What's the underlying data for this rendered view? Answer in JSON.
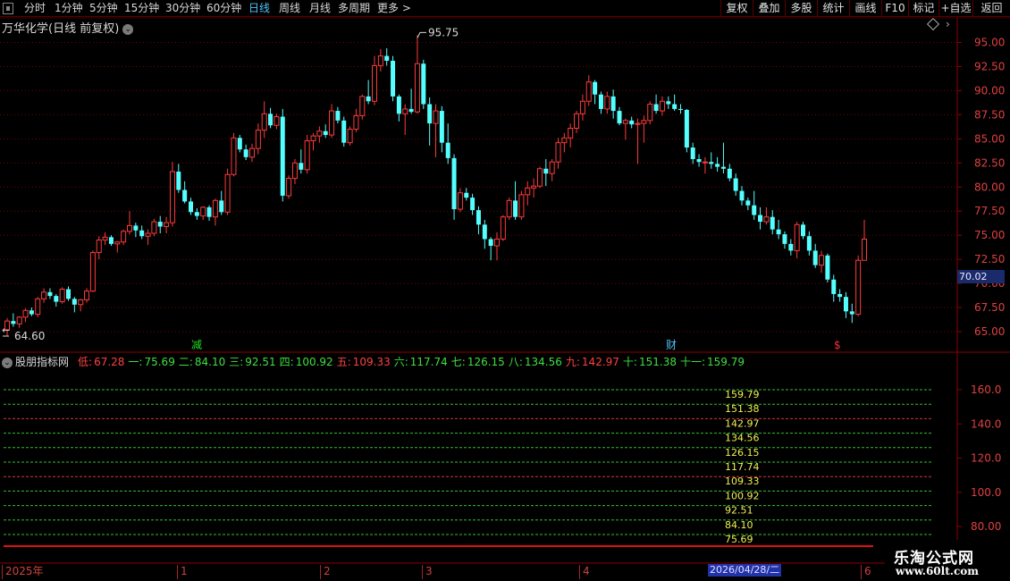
{
  "toolbar": {
    "periods": [
      {
        "label": "分时",
        "active": false
      },
      {
        "label": "1分钟",
        "active": false
      },
      {
        "label": "5分钟",
        "active": false
      },
      {
        "label": "15分钟",
        "active": false
      },
      {
        "label": "30分钟",
        "active": false
      },
      {
        "label": "60分钟",
        "active": false
      },
      {
        "label": "日线",
        "active": true
      },
      {
        "label": "周线",
        "active": false
      },
      {
        "label": "月线",
        "active": false
      },
      {
        "label": "多周期",
        "active": false
      },
      {
        "label": "更多 >",
        "active": false
      }
    ],
    "tools": [
      "复权",
      "叠加",
      "多股",
      "统计",
      "画线",
      "F10",
      "标记",
      "+自选",
      "返回"
    ]
  },
  "stock": {
    "title": "万华化学(日线 前复权)",
    "high_label": "95.75",
    "low_label": "64.60",
    "current_price": "70.02"
  },
  "price_axis": {
    "ticks": [
      "95.00",
      "92.50",
      "90.00",
      "87.50",
      "85.00",
      "82.50",
      "80.00",
      "77.50",
      "75.00",
      "72.50",
      "70.00",
      "67.50",
      "65.00"
    ]
  },
  "markers": [
    {
      "label": "减",
      "color": "#22dd22"
    },
    {
      "label": "财",
      "color": "#4fc3f7"
    },
    {
      "label": "$",
      "color": "#ff3030"
    }
  ],
  "indicator": {
    "name": "股朋指标网",
    "items": [
      {
        "label": "低:",
        "value": "67.28",
        "color": "#ff4040"
      },
      {
        "label": "一:",
        "value": "75.69",
        "color": "#3ee03e"
      },
      {
        "label": "二:",
        "value": "84.10",
        "color": "#3ee03e"
      },
      {
        "label": "三:",
        "value": "92.51",
        "color": "#3ee03e"
      },
      {
        "label": "四:",
        "value": "100.92",
        "color": "#3ee03e"
      },
      {
        "label": "五:",
        "value": "109.33",
        "color": "#ff4040"
      },
      {
        "label": "六:",
        "value": "117.74",
        "color": "#3ee03e"
      },
      {
        "label": "七:",
        "value": "126.15",
        "color": "#3ee03e"
      },
      {
        "label": "八:",
        "value": "134.56",
        "color": "#3ee03e"
      },
      {
        "label": "九:",
        "value": "142.97",
        "color": "#ff4040"
      },
      {
        "label": "十:",
        "value": "151.38",
        "color": "#3ee03e"
      },
      {
        "label": "十一:",
        "value": "159.79",
        "color": "#3ee03e"
      }
    ],
    "levels": [
      {
        "value": "159.79",
        "color": "#3ee03e"
      },
      {
        "value": "151.38",
        "color": "#3ee03e"
      },
      {
        "value": "142.97",
        "color": "#ff4040"
      },
      {
        "value": "134.56",
        "color": "#3ee03e"
      },
      {
        "value": "126.15",
        "color": "#3ee03e"
      },
      {
        "value": "117.74",
        "color": "#3ee03e"
      },
      {
        "value": "109.33",
        "color": "#ff4040"
      },
      {
        "value": "100.92",
        "color": "#3ee03e"
      },
      {
        "value": "92.51",
        "color": "#3ee03e"
      },
      {
        "value": "84.10",
        "color": "#3ee03e"
      },
      {
        "value": "75.69",
        "color": "#3ee03e"
      }
    ],
    "axis_ticks": [
      "160.0",
      "140.0",
      "120.0",
      "100.0",
      "80.00"
    ]
  },
  "date_axis": {
    "ticks": [
      "2025年",
      "1",
      "2",
      "3",
      "4",
      "5",
      "6"
    ],
    "cursor_date": "2026/04/28/二"
  },
  "watermark": {
    "title": "乐淘公式网",
    "url": "www.60lt.com"
  },
  "colors": {
    "up": "#ff3b3b",
    "down": "#54ffff",
    "frame": "#8b0000",
    "grid": "#7a0000"
  },
  "candles": [
    [
      65.2,
      66.4,
      64.6,
      66.1
    ],
    [
      66.1,
      66.9,
      65.5,
      65.8
    ],
    [
      65.8,
      66.6,
      65.4,
      66.5
    ],
    [
      66.5,
      67.4,
      66.0,
      67.2
    ],
    [
      67.2,
      67.5,
      66.6,
      66.8
    ],
    [
      66.8,
      68.6,
      66.5,
      68.4
    ],
    [
      68.4,
      69.5,
      68.0,
      69.1
    ],
    [
      69.1,
      69.5,
      68.4,
      68.7
    ],
    [
      68.7,
      68.9,
      67.6,
      68.1
    ],
    [
      68.1,
      69.6,
      67.9,
      69.4
    ],
    [
      69.4,
      69.7,
      68.2,
      68.4
    ],
    [
      68.4,
      68.6,
      67.0,
      67.8
    ],
    [
      67.8,
      68.4,
      67.1,
      68.3
    ],
    [
      68.3,
      69.5,
      68.0,
      69.2
    ],
    [
      69.2,
      73.4,
      69.1,
      73.2
    ],
    [
      73.2,
      74.9,
      72.5,
      74.5
    ],
    [
      74.5,
      75.3,
      74.0,
      74.8
    ],
    [
      74.8,
      75.0,
      73.9,
      74.1
    ],
    [
      74.1,
      74.4,
      73.2,
      74.3
    ],
    [
      74.3,
      75.6,
      74.0,
      75.4
    ],
    [
      75.4,
      77.5,
      75.1,
      76.0
    ],
    [
      76.0,
      76.3,
      74.8,
      75.5
    ],
    [
      75.5,
      76.0,
      74.6,
      74.9
    ],
    [
      74.9,
      75.6,
      74.0,
      75.2
    ],
    [
      75.2,
      76.7,
      74.9,
      76.4
    ],
    [
      76.4,
      77.0,
      75.2,
      75.9
    ],
    [
      75.9,
      76.9,
      75.2,
      76.3
    ],
    [
      76.3,
      82.6,
      75.9,
      81.6
    ],
    [
      81.6,
      82.4,
      79.4,
      79.7
    ],
    [
      79.7,
      80.6,
      78.3,
      78.5
    ],
    [
      78.5,
      78.9,
      77.1,
      77.4
    ],
    [
      77.4,
      77.8,
      76.6,
      77.0
    ],
    [
      77.0,
      78.0,
      76.6,
      77.9
    ],
    [
      77.9,
      78.1,
      76.5,
      76.9
    ],
    [
      76.9,
      78.8,
      76.0,
      78.6
    ],
    [
      78.6,
      79.6,
      77.1,
      77.4
    ],
    [
      77.4,
      81.9,
      77.1,
      81.3
    ],
    [
      81.3,
      85.6,
      81.1,
      85.1
    ],
    [
      85.1,
      85.4,
      83.6,
      83.9
    ],
    [
      83.9,
      84.4,
      82.8,
      83.1
    ],
    [
      83.1,
      84.5,
      82.6,
      84.0
    ],
    [
      84.0,
      86.6,
      83.4,
      85.9
    ],
    [
      85.9,
      88.9,
      85.1,
      87.6
    ],
    [
      87.6,
      88.2,
      86.1,
      86.4
    ],
    [
      86.4,
      87.6,
      86.0,
      87.3
    ],
    [
      87.3,
      88.1,
      78.5,
      79.1
    ],
    [
      79.1,
      81.2,
      78.8,
      80.9
    ],
    [
      80.9,
      82.9,
      80.3,
      82.5
    ],
    [
      82.5,
      83.9,
      81.4,
      81.8
    ],
    [
      81.8,
      85.4,
      81.4,
      84.8
    ],
    [
      84.8,
      85.6,
      83.8,
      85.3
    ],
    [
      85.3,
      86.3,
      84.6,
      85.8
    ],
    [
      85.8,
      86.5,
      85.1,
      85.4
    ],
    [
      85.4,
      88.6,
      85.1,
      87.9
    ],
    [
      87.9,
      88.3,
      86.6,
      86.9
    ],
    [
      86.9,
      87.3,
      84.2,
      84.6
    ],
    [
      84.6,
      86.3,
      84.3,
      86.0
    ],
    [
      86.0,
      88.1,
      85.7,
      87.4
    ],
    [
      87.4,
      89.6,
      87.0,
      89.4
    ],
    [
      89.4,
      91.1,
      88.6,
      88.9
    ],
    [
      88.9,
      93.6,
      88.5,
      92.6
    ],
    [
      92.6,
      94.3,
      92.0,
      93.6
    ],
    [
      93.6,
      94.4,
      92.6,
      93.1
    ],
    [
      93.1,
      93.6,
      88.9,
      89.4
    ],
    [
      89.4,
      89.6,
      86.8,
      87.6
    ],
    [
      87.6,
      88.6,
      85.4,
      88.1
    ],
    [
      88.1,
      90.2,
      87.6,
      87.8
    ],
    [
      87.8,
      95.75,
      87.6,
      92.8
    ],
    [
      92.8,
      93.2,
      88.1,
      88.6
    ],
    [
      88.6,
      89.3,
      84.3,
      86.6
    ],
    [
      86.6,
      88.6,
      83.1,
      87.9
    ],
    [
      87.9,
      88.4,
      83.6,
      84.6
    ],
    [
      84.6,
      86.6,
      82.4,
      83.0
    ],
    [
      83.0,
      83.4,
      76.6,
      77.7
    ],
    [
      77.7,
      79.9,
      77.4,
      79.4
    ],
    [
      79.4,
      79.9,
      78.6,
      78.9
    ],
    [
      78.9,
      79.3,
      77.1,
      77.6
    ],
    [
      77.6,
      78.0,
      75.1,
      76.1
    ],
    [
      76.1,
      76.6,
      73.6,
      74.6
    ],
    [
      74.6,
      74.8,
      72.4,
      73.9
    ],
    [
      73.9,
      75.3,
      72.4,
      74.6
    ],
    [
      74.6,
      77.1,
      74.4,
      76.9
    ],
    [
      76.9,
      78.9,
      76.6,
      78.6
    ],
    [
      78.6,
      80.6,
      76.6,
      76.9
    ],
    [
      76.9,
      79.6,
      76.6,
      79.2
    ],
    [
      79.2,
      80.6,
      78.1,
      79.9
    ],
    [
      79.9,
      80.9,
      78.9,
      80.1
    ],
    [
      80.1,
      82.1,
      79.9,
      81.9
    ],
    [
      81.9,
      82.9,
      80.1,
      81.4
    ],
    [
      81.4,
      82.9,
      80.6,
      82.6
    ],
    [
      82.6,
      85.1,
      81.9,
      84.6
    ],
    [
      84.6,
      85.6,
      83.6,
      85.1
    ],
    [
      85.1,
      86.6,
      84.1,
      86.1
    ],
    [
      86.1,
      87.9,
      85.6,
      87.6
    ],
    [
      87.6,
      89.6,
      86.9,
      88.9
    ],
    [
      88.9,
      91.6,
      88.4,
      90.9
    ],
    [
      90.9,
      91.1,
      88.6,
      89.6
    ],
    [
      89.6,
      89.9,
      87.6,
      88.1
    ],
    [
      88.1,
      89.9,
      87.6,
      89.4
    ],
    [
      89.4,
      90.1,
      87.1,
      87.9
    ],
    [
      87.9,
      88.3,
      86.4,
      86.6
    ],
    [
      86.6,
      87.1,
      84.9,
      86.9
    ],
    [
      86.9,
      87.3,
      86.1,
      86.5
    ],
    [
      86.5,
      87.1,
      82.4,
      86.6
    ],
    [
      86.6,
      87.4,
      84.6,
      86.9
    ],
    [
      86.9,
      88.9,
      86.5,
      88.6
    ],
    [
      88.6,
      89.6,
      87.6,
      87.9
    ],
    [
      87.9,
      89.4,
      87.4,
      88.9
    ],
    [
      88.9,
      89.4,
      88.1,
      88.6
    ],
    [
      88.6,
      89.6,
      87.9,
      88.1
    ],
    [
      88.1,
      88.6,
      87.6,
      88.0
    ],
    [
      88.0,
      88.1,
      83.6,
      84.1
    ],
    [
      84.1,
      84.6,
      82.4,
      82.9
    ],
    [
      82.9,
      83.4,
      82.1,
      82.6
    ],
    [
      82.6,
      83.1,
      81.4,
      82.6
    ],
    [
      82.6,
      83.6,
      81.9,
      82.4
    ],
    [
      82.4,
      83.1,
      81.6,
      82.1
    ],
    [
      82.1,
      84.6,
      81.4,
      81.9
    ],
    [
      81.9,
      82.4,
      80.6,
      80.9
    ],
    [
      80.9,
      81.4,
      79.1,
      79.6
    ],
    [
      79.6,
      80.1,
      78.1,
      78.6
    ],
    [
      78.6,
      78.9,
      77.6,
      78.1
    ],
    [
      78.1,
      79.6,
      76.6,
      77.1
    ],
    [
      77.1,
      77.9,
      75.6,
      76.4
    ],
    [
      76.4,
      77.9,
      76.1,
      76.9
    ],
    [
      76.9,
      77.6,
      75.1,
      75.6
    ],
    [
      75.6,
      76.6,
      74.6,
      75.1
    ],
    [
      75.1,
      75.4,
      73.6,
      74.1
    ],
    [
      74.1,
      74.6,
      72.9,
      73.4
    ],
    [
      73.4,
      76.4,
      72.6,
      76.1
    ],
    [
      76.1,
      76.4,
      74.6,
      74.9
    ],
    [
      74.9,
      75.4,
      72.9,
      73.4
    ],
    [
      73.4,
      74.1,
      71.6,
      71.9
    ],
    [
      71.9,
      73.4,
      71.1,
      72.9
    ],
    [
      72.9,
      73.1,
      70.1,
      70.4
    ],
    [
      70.4,
      70.9,
      68.1,
      68.9
    ],
    [
      68.9,
      69.4,
      68.1,
      68.6
    ],
    [
      68.6,
      69.1,
      66.4,
      67.1
    ],
    [
      67.1,
      67.9,
      65.9,
      66.8
    ],
    [
      66.8,
      72.9,
      66.6,
      72.4
    ],
    [
      72.4,
      76.6,
      72.4,
      74.6
    ]
  ]
}
